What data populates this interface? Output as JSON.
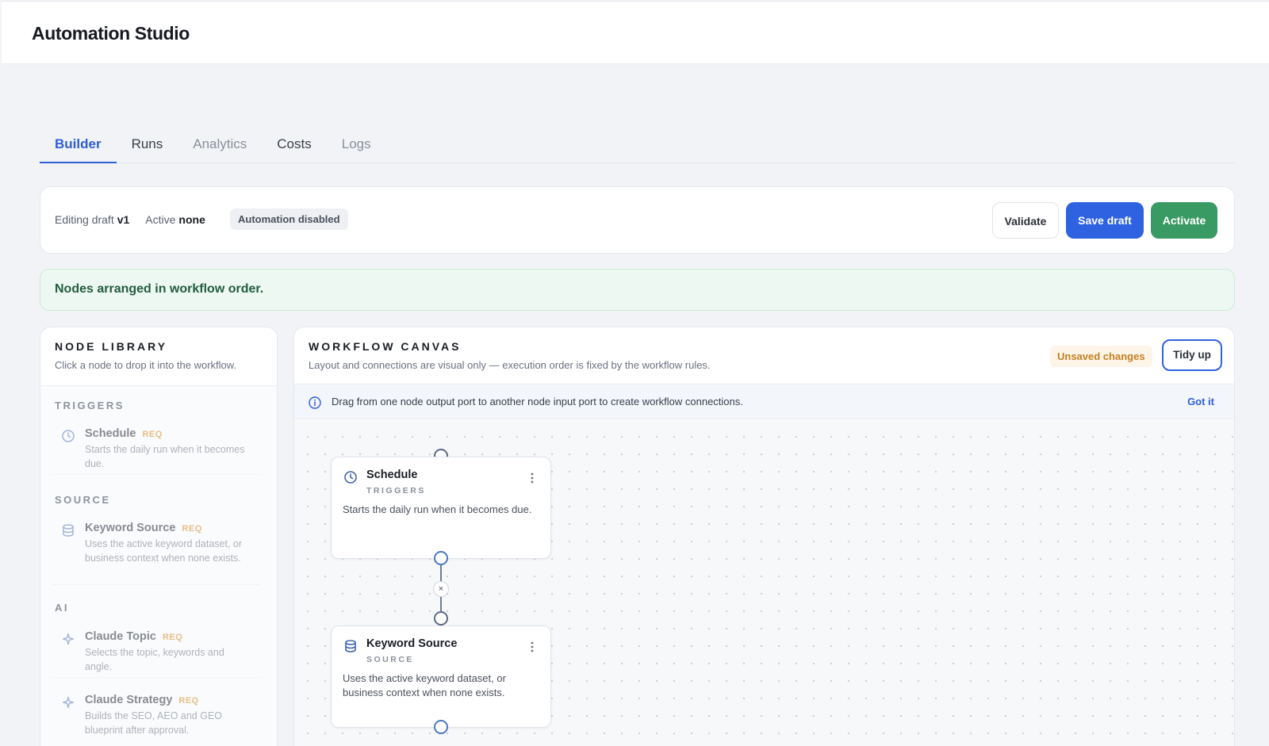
{
  "app": {
    "title": "Automation Studio"
  },
  "tabs": [
    {
      "label": "Builder",
      "state": "active"
    },
    {
      "label": "Runs",
      "state": "normal"
    },
    {
      "label": "Analytics",
      "state": "muted"
    },
    {
      "label": "Costs",
      "state": "normal"
    },
    {
      "label": "Logs",
      "state": "muted"
    }
  ],
  "draft": {
    "editing_label": "Editing draft",
    "editing_value": "v1",
    "active_label": "Active",
    "active_value": "none",
    "status_badge": "Automation disabled",
    "validate_label": "Validate",
    "save_label": "Save draft",
    "activate_label": "Activate"
  },
  "banner": {
    "message": "Nodes arranged in workflow order."
  },
  "library": {
    "title": "NODE LIBRARY",
    "subtitle": "Click a node to drop it into the workflow.",
    "groups": [
      {
        "label": "TRIGGERS",
        "items": [
          {
            "name": "Schedule",
            "tag": "REQ",
            "icon": "clock-icon",
            "desc": "Starts the daily run when it becomes due."
          }
        ]
      },
      {
        "label": "SOURCE",
        "items": [
          {
            "name": "Keyword Source",
            "tag": "REQ",
            "icon": "database-icon",
            "desc": "Uses the active keyword dataset, or business context when none exists."
          }
        ]
      },
      {
        "label": "AI",
        "items": [
          {
            "name": "Claude Topic",
            "tag": "REQ",
            "icon": "sparkle-icon",
            "desc": "Selects the topic, keywords and angle."
          },
          {
            "name": "Claude Strategy",
            "tag": "REQ",
            "icon": "sparkle-icon",
            "desc": "Builds the SEO, AEO and GEO blueprint after approval."
          }
        ]
      }
    ]
  },
  "canvas": {
    "title": "WORKFLOW CANVAS",
    "subtitle": "Layout and connections are visual only — execution order is fixed by the workflow rules.",
    "unsaved_label": "Unsaved changes",
    "tidy_label": "Tidy up",
    "hint": "Drag from one node output port to another node input port to create workflow connections.",
    "hint_dismiss": "Got it",
    "edge_delete": "×",
    "nodes": [
      {
        "name": "Schedule",
        "category": "TRIGGERS",
        "icon": "clock-icon",
        "desc": "Starts the daily run when it becomes due."
      },
      {
        "name": "Keyword Source",
        "category": "SOURCE",
        "icon": "database-icon",
        "desc": "Uses the active keyword dataset, or business context when none exists."
      }
    ]
  },
  "colors": {
    "accent": "#2f62e0",
    "success": "#3a9a63",
    "warning": "#c77f1f",
    "req_tag": "#d98e2c"
  }
}
